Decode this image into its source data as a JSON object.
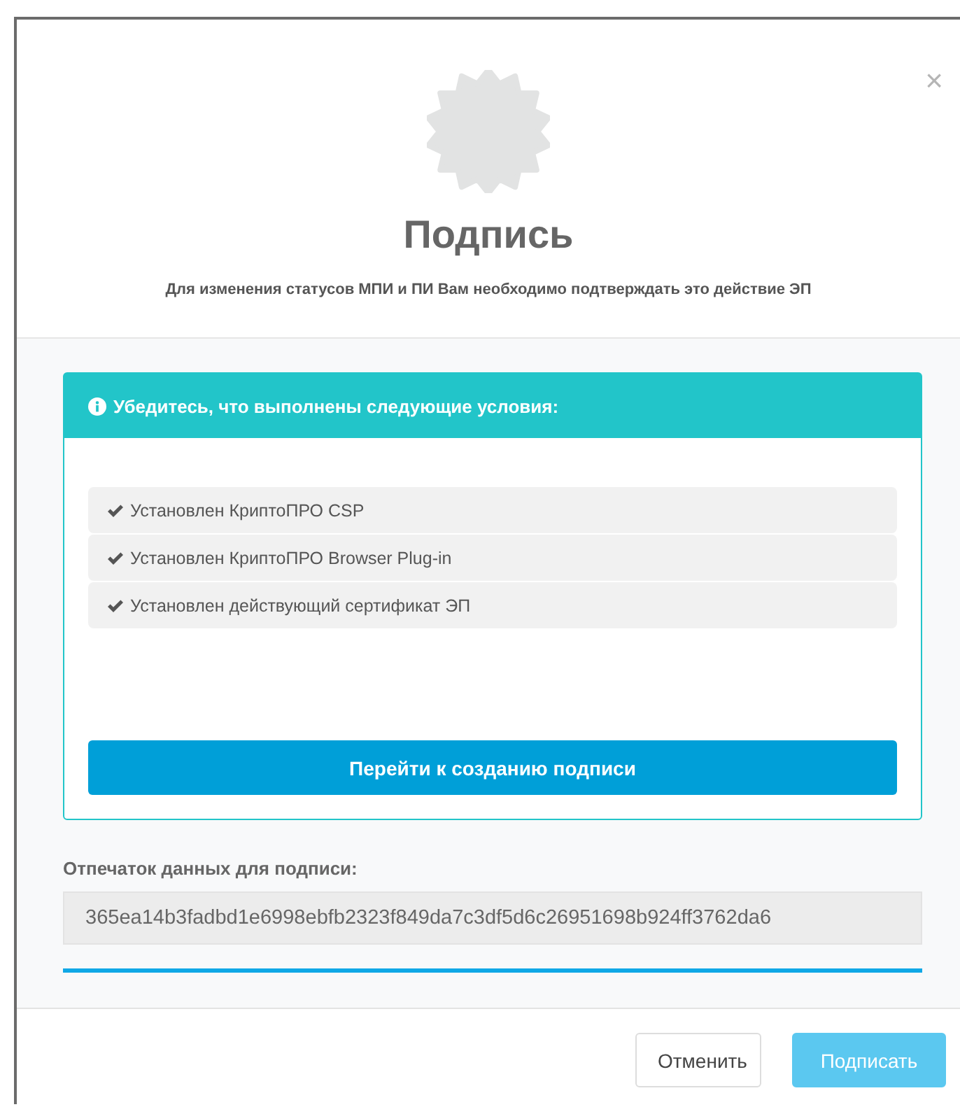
{
  "dialog": {
    "title": "Подпись",
    "subtitle": "Для изменения статусов МПИ и ПИ Вам необходимо подтверждать это действие ЭП",
    "close": "×"
  },
  "requirements": {
    "heading": "Убедитесь, что выполнены следующие условия:",
    "items": [
      {
        "label": "Установлен КриптоПРО CSP",
        "checked": true
      },
      {
        "label": "Установлен КриптоПРО Browser Plug-in",
        "checked": true
      },
      {
        "label": "Установлен действующий сертификат ЭП",
        "checked": true
      }
    ],
    "action": "Перейти к созданию подписи"
  },
  "fingerprint": {
    "label": "Отпечаток данных для подписи:",
    "value": "365ea14b3fadbd1e6998ebfb2323f849da7c3df5d6c26951698b924ff3762da6"
  },
  "footer": {
    "buttons": [
      {
        "label": "Отменить",
        "kind": "default",
        "disabled": false
      },
      {
        "label": "Подписать",
        "kind": "primary",
        "disabled": true
      }
    ]
  }
}
